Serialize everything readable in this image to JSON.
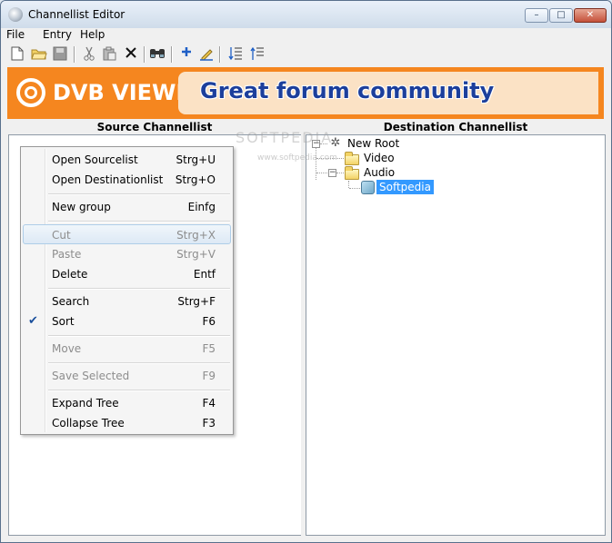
{
  "window": {
    "title": "Channellist Editor"
  },
  "controls": {
    "minimize": "–",
    "maximize": "□",
    "close": "✕"
  },
  "menu": {
    "items": [
      "File",
      "Entry",
      "Help"
    ]
  },
  "toolbar": {
    "icons": [
      "new-icon",
      "open-icon",
      "save-icon",
      "cut-icon",
      "paste-icon",
      "delete-icon",
      "search-icon",
      "add-icon",
      "edit-icon",
      "expand-tree-icon",
      "collapse-tree-icon"
    ]
  },
  "banner": {
    "logo_text": "DVB VIEWER",
    "slogan": "Great forum community"
  },
  "panels": {
    "source_title": "Source Channellist",
    "destination_title": "Destination Channellist"
  },
  "tree": {
    "root": "New Root",
    "folders": [
      "Video",
      "Audio"
    ],
    "selected_channel": "Softpedia"
  },
  "context_menu": {
    "items": [
      {
        "label": "Open Sourcelist",
        "shortcut": "Strg+U",
        "state": "enabled"
      },
      {
        "label": "Open Destinationlist",
        "shortcut": "Strg+O",
        "state": "enabled"
      },
      {
        "label": "New group",
        "shortcut": "Einfg",
        "state": "enabled"
      },
      {
        "label": "Cut",
        "shortcut": "Strg+X",
        "state": "disabled-hover"
      },
      {
        "label": "Paste",
        "shortcut": "Strg+V",
        "state": "disabled"
      },
      {
        "label": "Delete",
        "shortcut": "Entf",
        "state": "enabled"
      },
      {
        "label": "Search",
        "shortcut": "Strg+F",
        "state": "enabled"
      },
      {
        "label": "Sort",
        "shortcut": "F6",
        "state": "checked"
      },
      {
        "label": "Move",
        "shortcut": "F5",
        "state": "disabled"
      },
      {
        "label": "Save Selected",
        "shortcut": "F9",
        "state": "disabled"
      },
      {
        "label": "Expand Tree",
        "shortcut": "F4",
        "state": "enabled"
      },
      {
        "label": "Collapse Tree",
        "shortcut": "F3",
        "state": "enabled"
      }
    ]
  },
  "watermark": {
    "text": "SOFTPEDIA",
    "url": "www.softpedia.com"
  },
  "colors": {
    "banner": "#f5861f",
    "slogan": "#1c3f9c",
    "selection": "#3399ff"
  }
}
